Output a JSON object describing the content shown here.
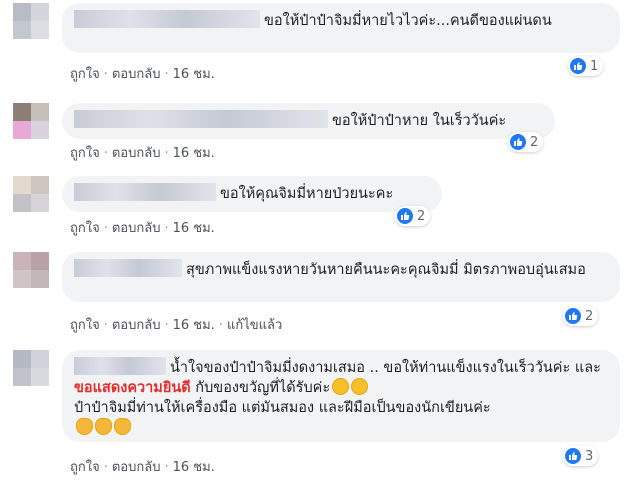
{
  "colors": {
    "bubble_bg": "#f2f3f5",
    "action_text": "#4b4f56",
    "like_blue": "#2078f4",
    "highlight": "#e0302d"
  },
  "comments": [
    {
      "text": "ขอให้ป๋าป๋าจิมมี่หายไวไวค่ะ...คนดีของแผ่นดน",
      "actions": {
        "like": "ถูกใจ",
        "reply": "ตอบกลับ",
        "time": "16 ชม."
      },
      "reactions": {
        "icon": "like-icon",
        "count": "1"
      }
    },
    {
      "text": "ขอให้ป๋าป๋าหาย ในเร็ววันค่ะ",
      "actions": {
        "like": "ถูกใจ",
        "reply": "ตอบกลับ",
        "time": "16 ชม."
      },
      "reactions": {
        "icon": "like-icon",
        "count": "2"
      }
    },
    {
      "text": "ขอให้คุณจิมมี่หายป่วยนะคะ",
      "actions": {
        "like": "ถูกใจ",
        "reply": "ตอบกลับ",
        "time": "16 ชม."
      },
      "reactions": {
        "icon": "like-icon",
        "count": "2"
      }
    },
    {
      "text": "สุขภาพแข็งแรงหายวันหายคืนนะคะคุณจิมมี่ มิตรภาพอบอุ่นเสมอ",
      "actions": {
        "like": "ถูกใจ",
        "reply": "ตอบกลับ",
        "time": "16 ชม.",
        "edited": "แก้ไขแล้ว"
      },
      "reactions": {
        "icon": "like-icon",
        "count": "2"
      }
    },
    {
      "text_part1": "น้ำใจของป๋าป๋าจิมมี่งดงามเสมอ .. ขอให้ท่านแข็งแรงในเร็ววันค่ะ และ",
      "text_highlight": "ขอแสดงความยินดี",
      "text_part2": "กับของขวัญที่ได้รับค่ะ",
      "text_part3": "ป๋าป๋าจิมมี่ท่านให้เครื่องมือ แต่มันสมอง และฝีมือเป็นของนักเขียนค่ะ",
      "emojis_line1": [
        "grinning-emoji",
        "grinning-emoji"
      ],
      "emojis_line3": [
        "clap-emoji",
        "clap-emoji",
        "clap-emoji"
      ],
      "actions": {
        "like": "ถูกใจ",
        "reply": "ตอบกลับ",
        "time": "16 ชม."
      },
      "reactions": {
        "icon": "like-icon",
        "count": "3"
      }
    }
  ]
}
